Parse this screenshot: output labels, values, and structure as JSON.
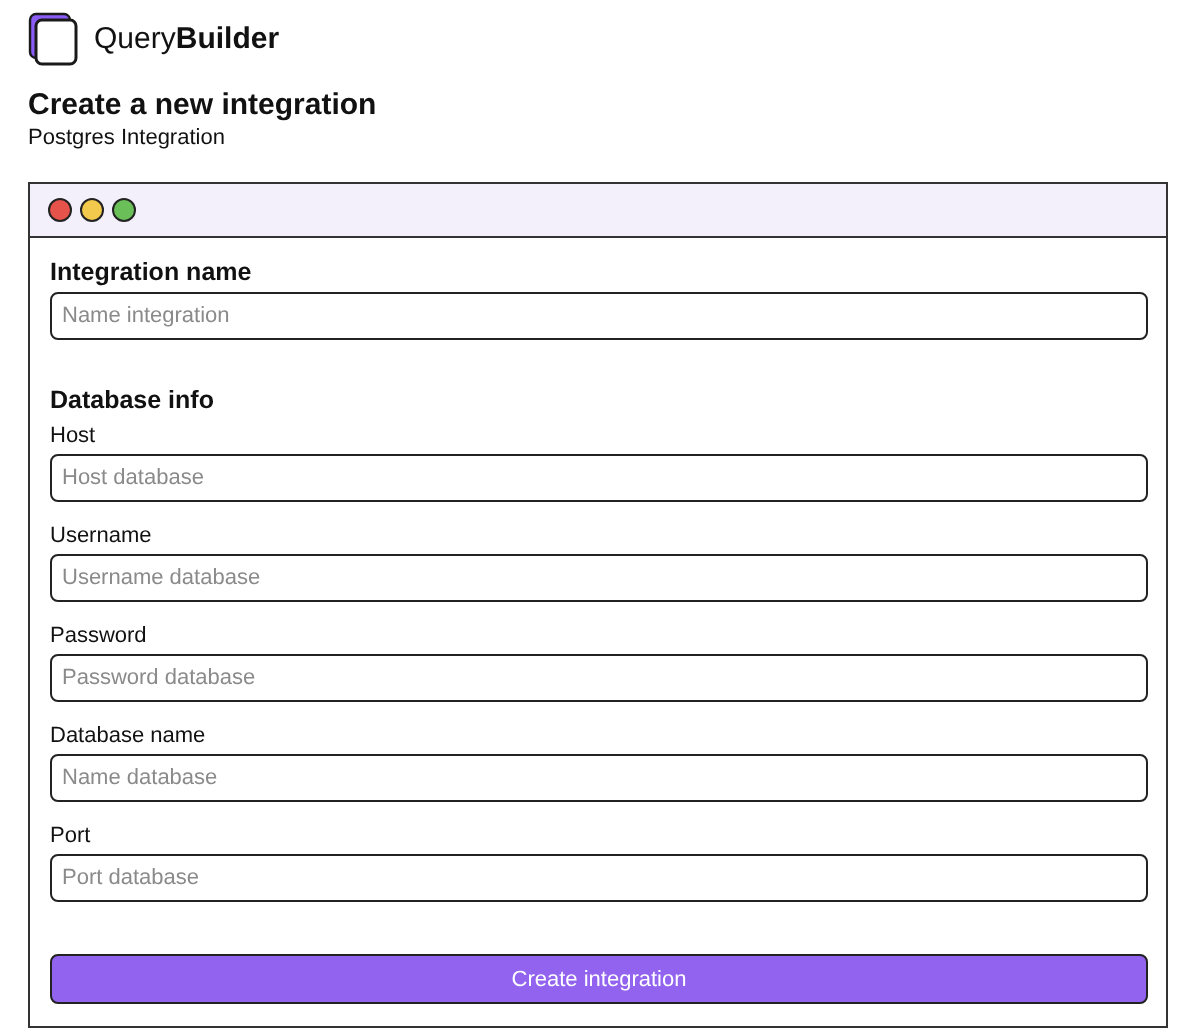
{
  "brand": {
    "name": "Query",
    "bold": "Builder"
  },
  "page": {
    "title": "Create a new integration",
    "subtitle": "Postgres Integration"
  },
  "window": {
    "controls": [
      {
        "color": "#e5534b"
      },
      {
        "color": "#f2c94c"
      },
      {
        "color": "#6abf58"
      }
    ]
  },
  "form": {
    "name_section": {
      "label": "Integration name",
      "placeholder": "Name integration"
    },
    "section_title": "Database info",
    "fields": [
      {
        "label": "Host",
        "placeholder": "Host database"
      },
      {
        "label": "Username",
        "placeholder": "Username database"
      },
      {
        "label": "Password",
        "placeholder": "Password database"
      },
      {
        "label": "Database name",
        "placeholder": "Name database"
      },
      {
        "label": "Port",
        "placeholder": "Port database"
      }
    ],
    "submit": "Create integration"
  }
}
